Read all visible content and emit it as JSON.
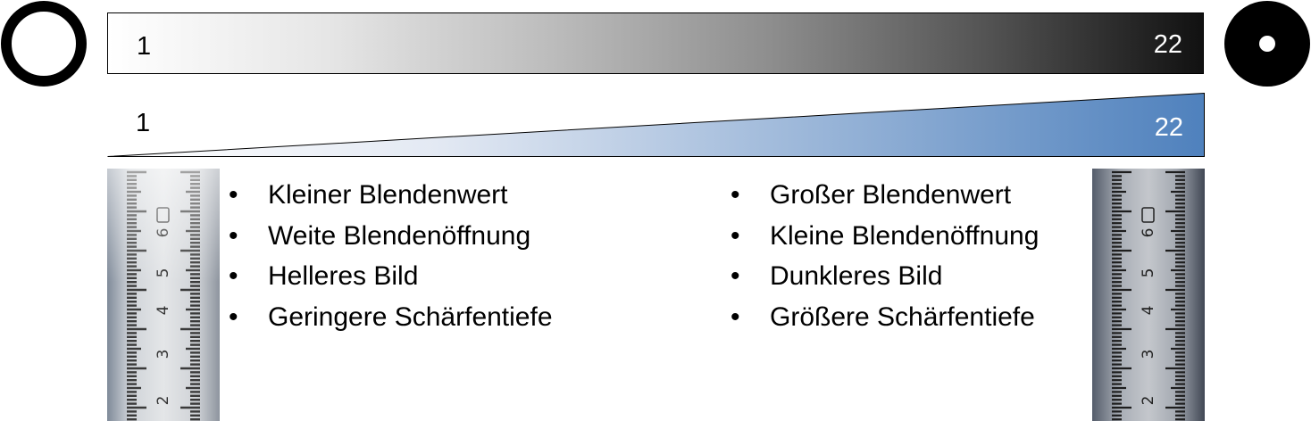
{
  "aperture_scale": {
    "gradient_bar": {
      "min_label": "1",
      "max_label": "22"
    },
    "wedge_bar": {
      "min_label": "1",
      "max_label": "22",
      "fill_color": "#4f81bd"
    }
  },
  "icons": {
    "left": "wide-aperture-ring-icon",
    "right": "narrow-aperture-icon"
  },
  "left_panel": {
    "image": "measuring-tape-shallow-depth-of-field",
    "bullets": [
      "Kleiner Blendenwert",
      "Weite Blendenöffnung",
      "Helleres Bild",
      "Geringere Schärfentiefe"
    ]
  },
  "right_panel": {
    "image": "measuring-tape-deep-depth-of-field",
    "bullets": [
      "Großer Blendenwert",
      "Kleine Blendenöffnung",
      "Dunkleres Bild",
      "Größere Schärfentiefe"
    ]
  }
}
